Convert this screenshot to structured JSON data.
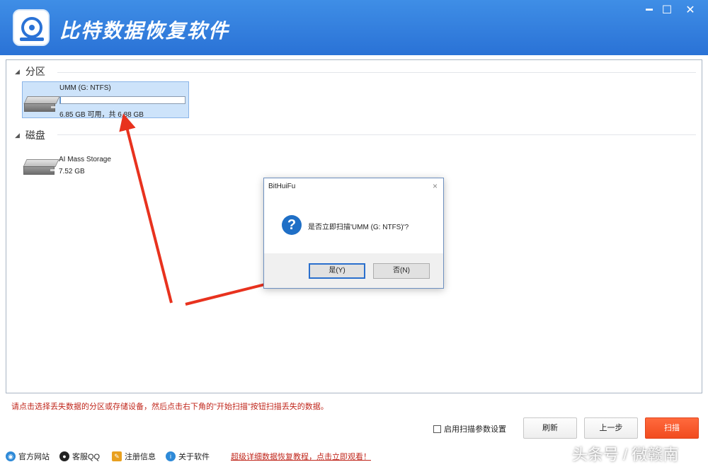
{
  "app": {
    "title": "比特数据恢复软件"
  },
  "window_controls": {
    "minimize": "━",
    "maximize": "☐",
    "close": "✕"
  },
  "sections": {
    "partitions": {
      "label": "分区",
      "items": [
        {
          "name": "UMM (G: NTFS)",
          "size_text": "6.85 GB 可用，共 6.88 GB",
          "used_fraction": 0.004
        }
      ]
    },
    "disks": {
      "label": "磁盘",
      "items": [
        {
          "name": "AI Mass Storage",
          "size_text": "7.52 GB"
        }
      ]
    }
  },
  "dialog": {
    "title": "BitHuiFu",
    "close": "×",
    "icon": "?",
    "message": "是否立即扫描'UMM (G: NTFS)'?",
    "yes_label": "是(Y)",
    "no_label": "否(N)"
  },
  "hint": "请点击选择丢失数据的分区或存储设备，然后点击右下角的\"开始扫描\"按钮扫描丢失的数据。",
  "controls": {
    "enable_scan_params": "启用扫描参数设置",
    "refresh": "刷新",
    "prev": "上一步",
    "scan": "扫描"
  },
  "footer": {
    "website": "官方网站",
    "support": "客服QQ",
    "register": "注册信息",
    "about": "关于软件",
    "promo": "超级详细数据恢复教程，点击立即观看！"
  },
  "watermark": "头条号 / 微赣南",
  "icons": {
    "app_logo": "disk-recovery-icon",
    "drive": "hard-drive-icon",
    "question": "question-icon",
    "website": "globe-icon",
    "support": "penguin-icon",
    "register": "pencil-icon",
    "about": "info-globe-icon"
  },
  "colors": {
    "titlebar": "#2a72d6",
    "hint_text": "#c0271c",
    "primary_button": "#f14b1f",
    "selection": "#cde3fa",
    "annotation_arrow": "#e8321e"
  }
}
